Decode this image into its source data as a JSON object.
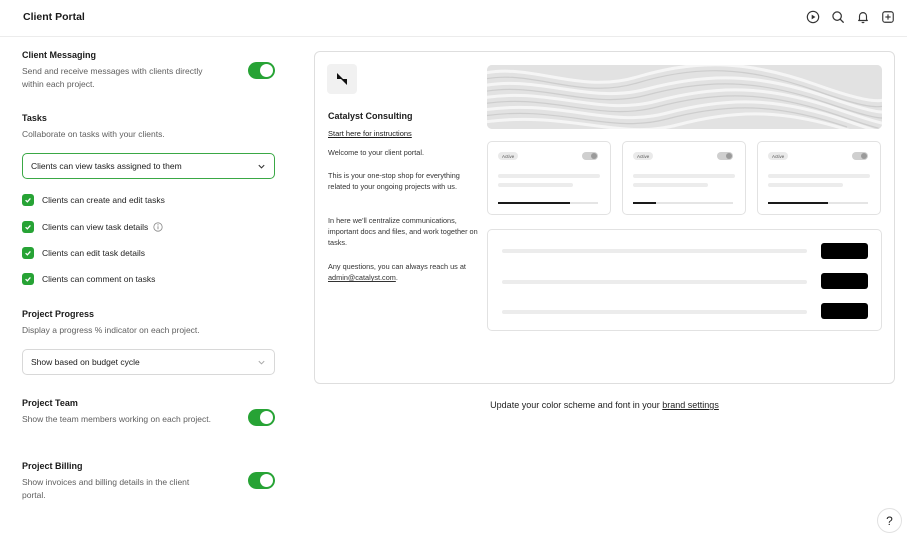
{
  "header": {
    "title": "Client Portal",
    "icons": [
      "play-icon",
      "search-icon",
      "bell-icon",
      "plus-square-icon"
    ]
  },
  "settings": {
    "messaging": {
      "title": "Client Messaging",
      "desc": "Send and receive messages with clients directly within each project.",
      "enabled": true
    },
    "tasks": {
      "title": "Tasks",
      "desc": "Collaborate on tasks with your clients.",
      "visibility_select": "Clients can view tasks assigned to them",
      "options": [
        {
          "label": "Clients can create and edit tasks",
          "checked": true
        },
        {
          "label": "Clients can view task details",
          "checked": true
        },
        {
          "label": "Clients can edit task details",
          "checked": true
        },
        {
          "label": "Clients can comment on tasks",
          "checked": true
        }
      ]
    },
    "progress": {
      "title": "Project Progress",
      "desc": "Display a progress % indicator on each project.",
      "select": "Show based on budget cycle"
    },
    "team": {
      "title": "Project Team",
      "desc": "Show the team members working on each project.",
      "enabled": true
    },
    "billing": {
      "title": "Project Billing",
      "desc": "Show invoices and billing details in the client portal.",
      "enabled": true
    }
  },
  "preview": {
    "company": "Catalyst Consulting",
    "instructions_link": "Start here for instructions",
    "welcome": "Welcome to your client portal.",
    "p1": "This is your one-stop shop for everything related to your ongoing projects with us.",
    "p2": "In here we'll centralize communications, important docs and files, and work together on tasks.",
    "p3_prefix": "Any questions, you can always reach us at ",
    "email": "admin@catalyst.com",
    "p3_suffix": ".",
    "cards": [
      {
        "badge": "Active",
        "progress": 0.72
      },
      {
        "badge": "Active",
        "progress": 0.23
      },
      {
        "badge": "Active",
        "progress": 0.6
      }
    ]
  },
  "footer": {
    "brand_note_prefix": "Update your color scheme and font in your ",
    "brand_link": "brand settings",
    "help": "?"
  },
  "colors": {
    "accent_green": "#27a335",
    "text": "#1f1f1f"
  }
}
